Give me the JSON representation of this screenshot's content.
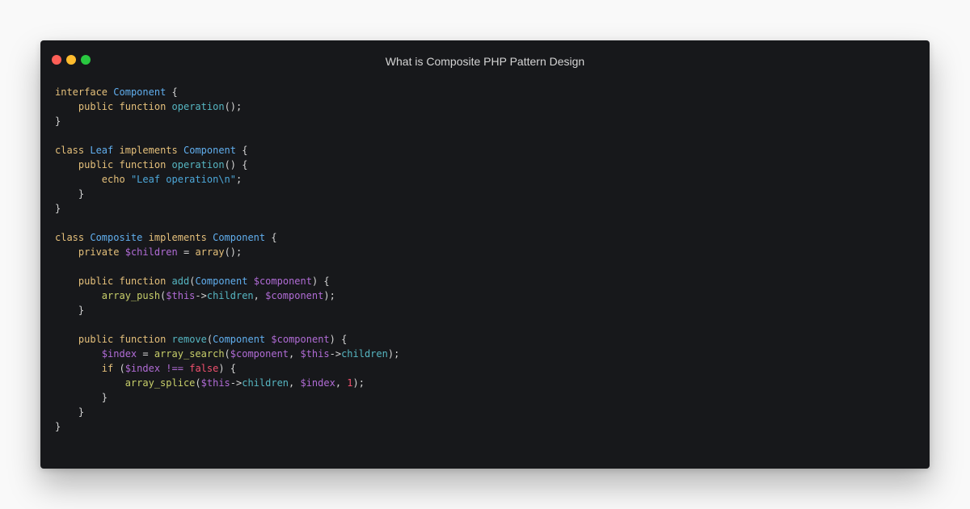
{
  "window": {
    "title": "What is Composite PHP Pattern Design",
    "controls": {
      "close": "close-button",
      "minimize": "minimize-button",
      "maximize": "maximize-button"
    }
  },
  "colors": {
    "background": "#f9f9f9",
    "editor_bg": "#17181b",
    "keyword": "#e5c07b",
    "type": "#61afef",
    "function": "#56b6c2",
    "builtin": "#c8cf6a",
    "variable": "#b16cd6",
    "string": "#4da8da",
    "number": "#f0506e",
    "punctuation": "#d4d4d4"
  },
  "code": {
    "language": "PHP",
    "lines": [
      [
        [
          "kw",
          "interface"
        ],
        [
          "punc",
          " "
        ],
        [
          "type",
          "Component"
        ],
        [
          "punc",
          " {"
        ]
      ],
      [
        [
          "punc",
          "    "
        ],
        [
          "kw",
          "public"
        ],
        [
          "punc",
          " "
        ],
        [
          "kw",
          "function"
        ],
        [
          "punc",
          " "
        ],
        [
          "fn",
          "operation"
        ],
        [
          "punc",
          "();"
        ]
      ],
      [
        [
          "punc",
          "}"
        ]
      ],
      [],
      [
        [
          "kw",
          "class"
        ],
        [
          "punc",
          " "
        ],
        [
          "type",
          "Leaf"
        ],
        [
          "punc",
          " "
        ],
        [
          "kw",
          "implements"
        ],
        [
          "punc",
          " "
        ],
        [
          "type",
          "Component"
        ],
        [
          "punc",
          " {"
        ]
      ],
      [
        [
          "punc",
          "    "
        ],
        [
          "kw",
          "public"
        ],
        [
          "punc",
          " "
        ],
        [
          "kw",
          "function"
        ],
        [
          "punc",
          " "
        ],
        [
          "fn",
          "operation"
        ],
        [
          "punc",
          "() {"
        ]
      ],
      [
        [
          "punc",
          "        "
        ],
        [
          "kw",
          "echo"
        ],
        [
          "punc",
          " "
        ],
        [
          "str",
          "\"Leaf operation\\n\""
        ],
        [
          "punc",
          ";"
        ]
      ],
      [
        [
          "punc",
          "    }"
        ]
      ],
      [
        [
          "punc",
          "}"
        ]
      ],
      [],
      [
        [
          "kw",
          "class"
        ],
        [
          "punc",
          " "
        ],
        [
          "type",
          "Composite"
        ],
        [
          "punc",
          " "
        ],
        [
          "kw",
          "implements"
        ],
        [
          "punc",
          " "
        ],
        [
          "type",
          "Component"
        ],
        [
          "punc",
          " {"
        ]
      ],
      [
        [
          "punc",
          "    "
        ],
        [
          "kw",
          "private"
        ],
        [
          "punc",
          " "
        ],
        [
          "var",
          "$children"
        ],
        [
          "punc",
          " = "
        ],
        [
          "kw",
          "array"
        ],
        [
          "punc",
          "();"
        ]
      ],
      [],
      [
        [
          "punc",
          "    "
        ],
        [
          "kw",
          "public"
        ],
        [
          "punc",
          " "
        ],
        [
          "kw",
          "function"
        ],
        [
          "punc",
          " "
        ],
        [
          "fn",
          "add"
        ],
        [
          "punc",
          "("
        ],
        [
          "type",
          "Component"
        ],
        [
          "punc",
          " "
        ],
        [
          "var",
          "$component"
        ],
        [
          "punc",
          ") {"
        ]
      ],
      [
        [
          "punc",
          "        "
        ],
        [
          "builtin",
          "array_push"
        ],
        [
          "punc",
          "("
        ],
        [
          "var",
          "$this"
        ],
        [
          "punc",
          "->"
        ],
        [
          "prop",
          "children"
        ],
        [
          "punc",
          ", "
        ],
        [
          "var",
          "$component"
        ],
        [
          "punc",
          ");"
        ]
      ],
      [
        [
          "punc",
          "    }"
        ]
      ],
      [],
      [
        [
          "punc",
          "    "
        ],
        [
          "kw",
          "public"
        ],
        [
          "punc",
          " "
        ],
        [
          "kw",
          "function"
        ],
        [
          "punc",
          " "
        ],
        [
          "fn",
          "remove"
        ],
        [
          "punc",
          "("
        ],
        [
          "type",
          "Component"
        ],
        [
          "punc",
          " "
        ],
        [
          "var",
          "$component"
        ],
        [
          "punc",
          ") {"
        ]
      ],
      [
        [
          "punc",
          "        "
        ],
        [
          "var",
          "$index"
        ],
        [
          "punc",
          " = "
        ],
        [
          "builtin",
          "array_search"
        ],
        [
          "punc",
          "("
        ],
        [
          "var",
          "$component"
        ],
        [
          "punc",
          ", "
        ],
        [
          "var",
          "$this"
        ],
        [
          "punc",
          "->"
        ],
        [
          "prop",
          "children"
        ],
        [
          "punc",
          ");"
        ]
      ],
      [
        [
          "punc",
          "        "
        ],
        [
          "kw",
          "if"
        ],
        [
          "punc",
          " ("
        ],
        [
          "var",
          "$index"
        ],
        [
          "punc",
          " "
        ],
        [
          "var",
          "!=="
        ],
        [
          "punc",
          " "
        ],
        [
          "bool",
          "false"
        ],
        [
          "punc",
          ") {"
        ]
      ],
      [
        [
          "punc",
          "            "
        ],
        [
          "builtin",
          "array_splice"
        ],
        [
          "punc",
          "("
        ],
        [
          "var",
          "$this"
        ],
        [
          "punc",
          "->"
        ],
        [
          "prop",
          "children"
        ],
        [
          "punc",
          ", "
        ],
        [
          "var",
          "$index"
        ],
        [
          "punc",
          ", "
        ],
        [
          "num",
          "1"
        ],
        [
          "punc",
          ");"
        ]
      ],
      [
        [
          "punc",
          "        }"
        ]
      ],
      [
        [
          "punc",
          "    }"
        ]
      ],
      [
        [
          "punc",
          "}"
        ]
      ]
    ]
  }
}
